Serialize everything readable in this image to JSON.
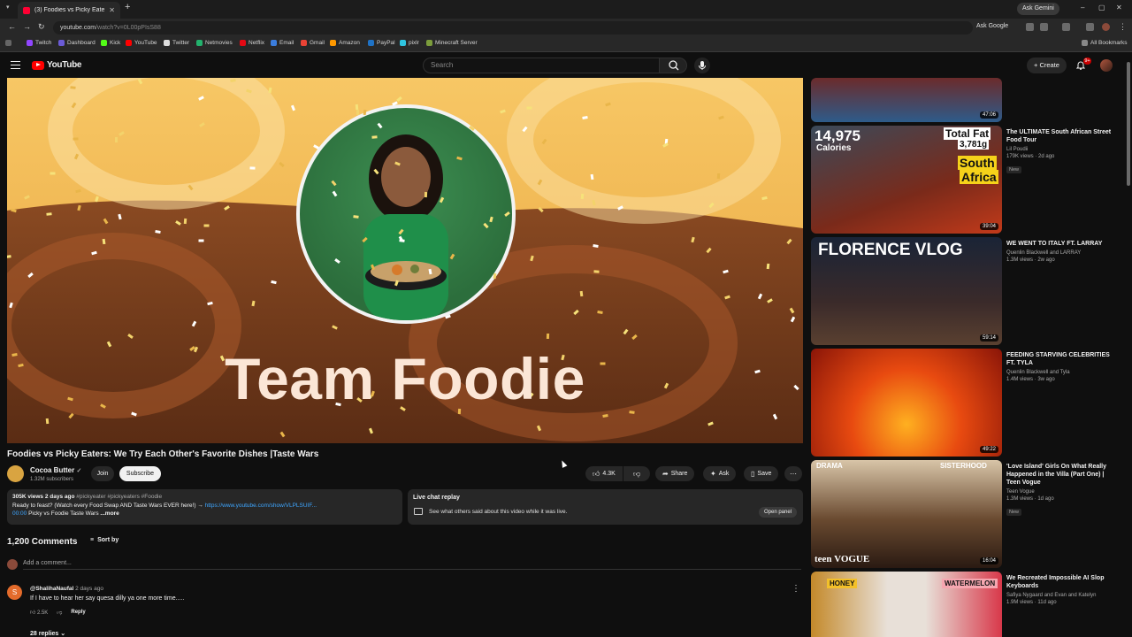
{
  "browser": {
    "tab_title": "(3) Foodies vs Picky Eaters: We",
    "url": "youtube.com",
    "url_path": "/watch?v=0L00pPIsS88",
    "ask_gemini": "Ask Gemini",
    "ask_google": "Ask Google",
    "all_bookmarks": "All Bookmarks",
    "bookmarks": [
      "Twitch",
      "Dashboard",
      "Kick",
      "YouTube",
      "Twitter",
      "Netmovies",
      "Netflix",
      "Email",
      "Gmail",
      "Amazon",
      "PayPal",
      "pixlr",
      "Minecraft Server"
    ]
  },
  "header": {
    "logo_text": "YouTube",
    "search_placeholder": "Search",
    "create_label": "Create",
    "notification_count": "9+"
  },
  "player": {
    "overlay_title": "Team Foodie"
  },
  "video": {
    "title": "Foodies vs Picky Eaters: We Try Each Other's Favorite Dishes  |Taste Wars",
    "channel": "Cocoa Butter",
    "subscribers": "1.32M subscribers",
    "join_label": "Join",
    "subscribe_label": "Subscribe",
    "likes": "4.3K",
    "share_label": "Share",
    "ask_label": "Ask",
    "save_label": "Save"
  },
  "description": {
    "stats": "305K views  2 days ago",
    "tags": "#pickyeater #pickyeaters #Foodie",
    "line2": "Ready to feast? (Watch every Food Swap AND Taste Wars EVER here!) →",
    "link": "https://www.youtube.com/show/VLPLSUIF...",
    "timestamp": "00:00",
    "line3": "Picky vs Foodie Taste Wars",
    "more": "...more"
  },
  "live_chat": {
    "title": "Live chat replay",
    "text": "See what others said about this video while it was live.",
    "open_panel": "Open panel"
  },
  "comments": {
    "count": "1,200 Comments",
    "sort_label": "Sort by",
    "add_placeholder": "Add a comment...",
    "items": [
      {
        "avatar_letter": "S",
        "author": "@ShalihaNaufal",
        "time": "2 days ago",
        "text": "If I have to hear her say quesa dilly ya one more time.....",
        "likes": "2.5K",
        "reply_label": "Reply",
        "replies": "28 replies"
      }
    ]
  },
  "recommendations": [
    {
      "title": "",
      "channel": "",
      "stats": "",
      "duration": "47:06",
      "badge": ""
    },
    {
      "title": "The ULTIMATE South African Street Food Tour",
      "channel": "Lil Poudii",
      "stats": "179K views · 2d ago",
      "duration": "39:04",
      "badge": "New",
      "thumb_text_1": "14,975",
      "thumb_text_2": "Calories",
      "thumb_text_3": "Total Fat",
      "thumb_text_4": "3,781g",
      "thumb_text_5": "South",
      "thumb_text_6": "Africa"
    },
    {
      "title": "WE WENT TO ITALY FT. LARRAY",
      "channel": "Quenlin Blackwell  and LARRAY",
      "stats": "1.3M views · 2w ago",
      "duration": "59:14",
      "badge": "",
      "thumb_text_1": "FLORENCE VLOG"
    },
    {
      "title": "FEEDING STARVING CELEBRITIES FT. TYLA",
      "channel": "Quenlin Blackwell  and Tyla",
      "stats": "1.4M views · 3w ago",
      "duration": "49:22",
      "badge": ""
    },
    {
      "title": "'Love Island' Girls On What Really Happened in the Villa (Part One) | Teen Vogue",
      "channel": "Teen Vogue",
      "stats": "1.3M views · 1d ago",
      "duration": "16:04",
      "badge": "New",
      "thumb_text_1": "DRAMA",
      "thumb_text_2": "SISTERHOOD",
      "thumb_text_3": "teen VOGUE"
    },
    {
      "title": "We Recreated Impossible AI Slop Keyboards",
      "channel": "Safiya Nygaard  and Evan and Katelyn",
      "stats": "1.9M views · 11d ago",
      "duration": "",
      "badge": "",
      "thumb_text_1": "HONEY",
      "thumb_text_2": "WATERMELON"
    }
  ]
}
